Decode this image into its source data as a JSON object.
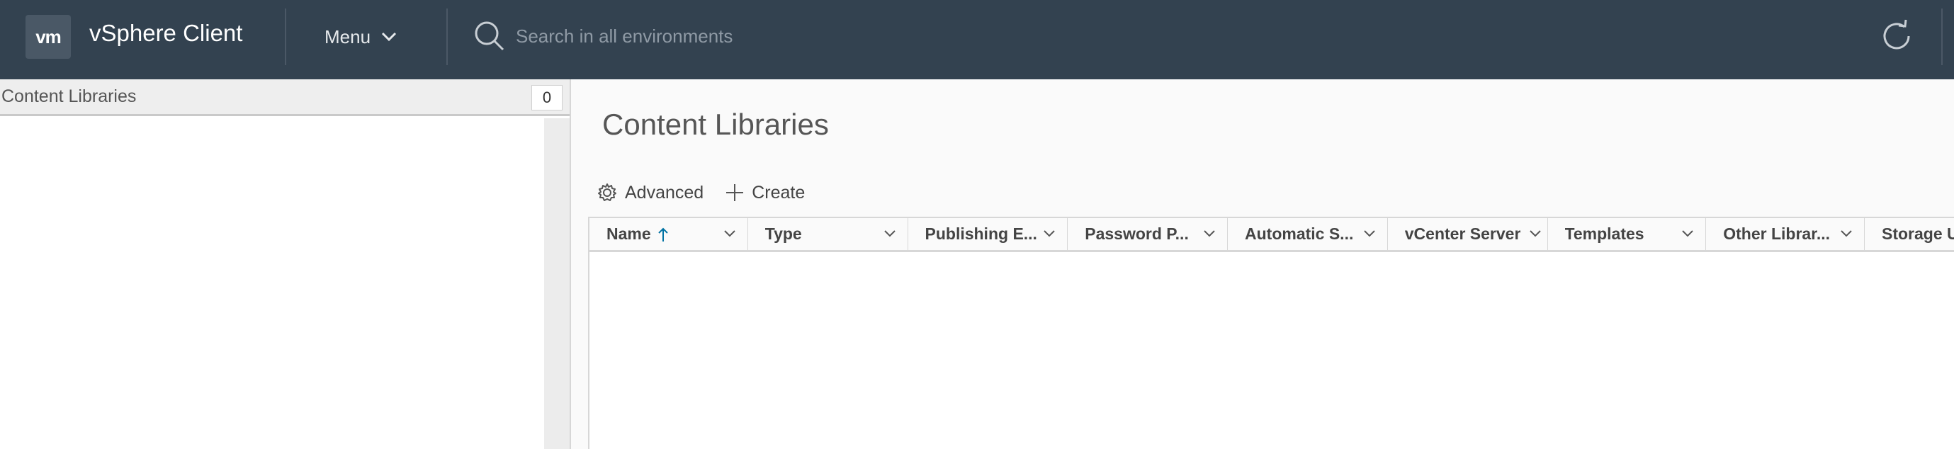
{
  "header": {
    "logo_text": "vm",
    "app_title": "vSphere Client",
    "menu_label": "Menu",
    "search_placeholder": "Search in all environments"
  },
  "left_panel": {
    "title": "Content Libraries",
    "count": "0"
  },
  "main": {
    "title": "Content Libraries",
    "toolbar": {
      "advanced_label": "Advanced",
      "create_label": "Create"
    },
    "columns": [
      {
        "label": "Name"
      },
      {
        "label": "Type"
      },
      {
        "label": "Publishing E..."
      },
      {
        "label": "Password P..."
      },
      {
        "label": "Automatic S..."
      },
      {
        "label": "vCenter Server"
      },
      {
        "label": "Templates"
      },
      {
        "label": "Other Librar..."
      },
      {
        "label": "Storage U"
      }
    ]
  },
  "colors": {
    "header_bg": "#334250",
    "accent": "#0072a3"
  }
}
